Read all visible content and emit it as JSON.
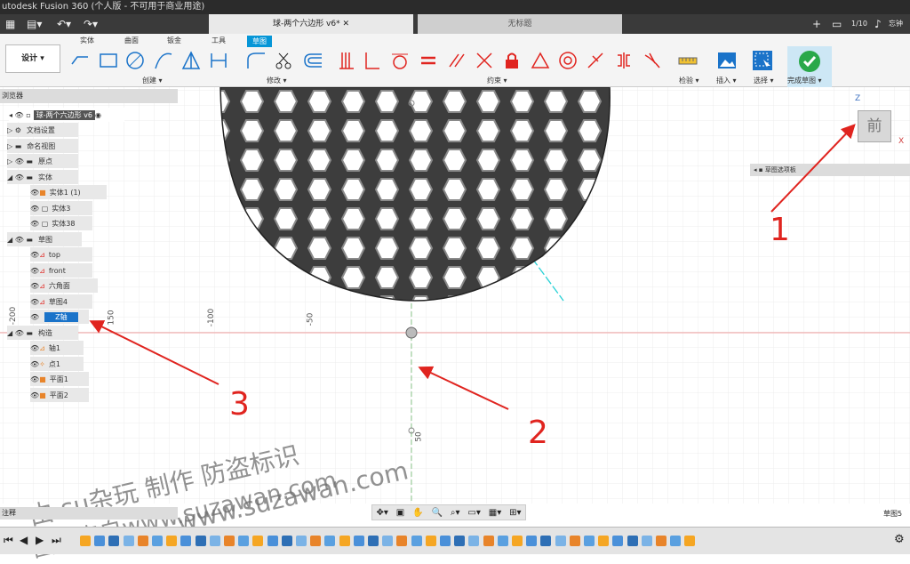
{
  "window": {
    "title": "utodesk Fusion 360 (个人版 - 不可用于商业用途)"
  },
  "tabs": [
    {
      "label": "球-两个六边形 v6*"
    },
    {
      "label": "无标题"
    }
  ],
  "header_right": {
    "job": "1/10",
    "user": "忘钟"
  },
  "workspace": {
    "label": "设计 ▾"
  },
  "toolbar": {
    "categories": [
      "实体",
      "曲面",
      "钣金",
      "工具",
      "草图"
    ],
    "groups": [
      "创建 ▾",
      "修改 ▾",
      "约束 ▾",
      "检验 ▾",
      "插入 ▾",
      "选择 ▾",
      "完成草图 ▾"
    ]
  },
  "browser": {
    "title": "浏览器",
    "nodes": [
      {
        "label": "球-两个六边形 v6"
      },
      {
        "label": "文档设置"
      },
      {
        "label": "命名视图"
      },
      {
        "label": "原点"
      },
      {
        "label": "实体"
      },
      {
        "label": "实体1 (1)"
      },
      {
        "label": "实体3"
      },
      {
        "label": "实体38"
      },
      {
        "label": "草图"
      },
      {
        "label": "top"
      },
      {
        "label": "front"
      },
      {
        "label": "六角面"
      },
      {
        "label": "草图4"
      },
      {
        "label": "Z轴"
      },
      {
        "label": "构造"
      },
      {
        "label": "轴1"
      },
      {
        "label": "点1"
      },
      {
        "label": "平面1"
      },
      {
        "label": "平面2"
      }
    ]
  },
  "viewport": {
    "ruler_labels": [
      "-200",
      "150",
      "-100",
      "-50",
      "50"
    ],
    "viewcube_face": "前",
    "axis_z": "Z",
    "axis_x": "X",
    "sketch_palette": "草图选项板"
  },
  "annotations": {
    "n1": "1",
    "n2": "2",
    "n3": "3"
  },
  "watermark": {
    "line1": "由 su杂玩 制作 防盗标识",
    "line2": "www.suzawan.com",
    "line3": "图片来自www.suzawan.com"
  },
  "status": {
    "left": "注释",
    "right": "草图5"
  },
  "colors": {
    "accent": "#0696d7",
    "annotation": "#e0241f",
    "finish": "#2aa84a"
  }
}
